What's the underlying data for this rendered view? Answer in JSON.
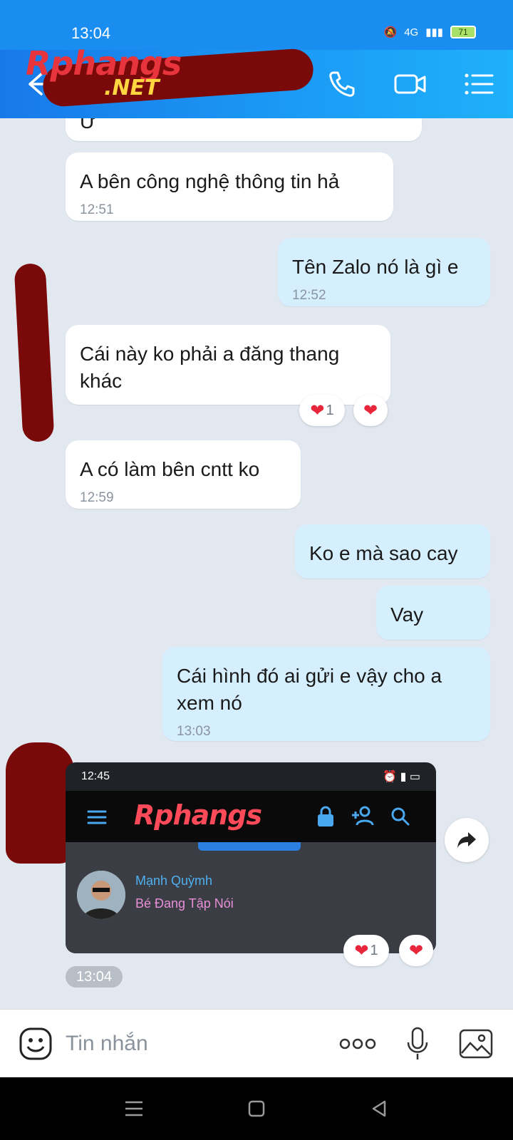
{
  "status_bar": {
    "time": "13:04",
    "network": "4G",
    "battery": "71"
  },
  "header": {
    "logo_main": "Rphangs",
    "logo_sub": ".NET",
    "icons": [
      "back-arrow-icon",
      "phone-icon",
      "video-camera-icon",
      "list-menu-icon"
    ]
  },
  "messages": [
    {
      "id": "m0",
      "direction": "in",
      "text": "Ừ",
      "time": ""
    },
    {
      "id": "m1",
      "direction": "in",
      "text": "A bên công nghệ thông tin hả",
      "time": "12:51"
    },
    {
      "id": "m2",
      "direction": "out",
      "text": "Tên Zalo nó là gì e",
      "time": "12:52"
    },
    {
      "id": "m3",
      "direction": "in",
      "text": "Cái này ko phải a đăng thang khác",
      "time": "",
      "reaction_count": "1"
    },
    {
      "id": "m4",
      "direction": "in",
      "text": "A có làm bên cntt ko",
      "time": "12:59"
    },
    {
      "id": "m5",
      "direction": "out",
      "text": "Ko e mà sao cay",
      "time": ""
    },
    {
      "id": "m6",
      "direction": "out",
      "text": "Vay",
      "time": ""
    },
    {
      "id": "m7",
      "direction": "out",
      "text": "Cái hình đó ai gửi e vậy cho a xem nó",
      "time": "13:03"
    }
  ],
  "image_message": {
    "status_time": "12:45",
    "logo": "Rphangs",
    "user_name": "Mạnh Quỳmh",
    "user_role": "Bé Đang Tập Nói",
    "reaction_count": "1",
    "time": "13:04"
  },
  "input_bar": {
    "placeholder": "Tin nhắn",
    "icons": [
      "sticker-icon",
      "more-icon",
      "microphone-icon",
      "image-icon"
    ]
  },
  "nav_bar": {
    "icons": [
      "recent-apps-icon",
      "home-icon",
      "back-icon"
    ]
  },
  "colors": {
    "header": "#1a8ef0",
    "bubble_out": "#d6efff",
    "bubble_in": "#ffffff",
    "heart": "#e8253a",
    "chat_bg": "#e2e8f0"
  }
}
